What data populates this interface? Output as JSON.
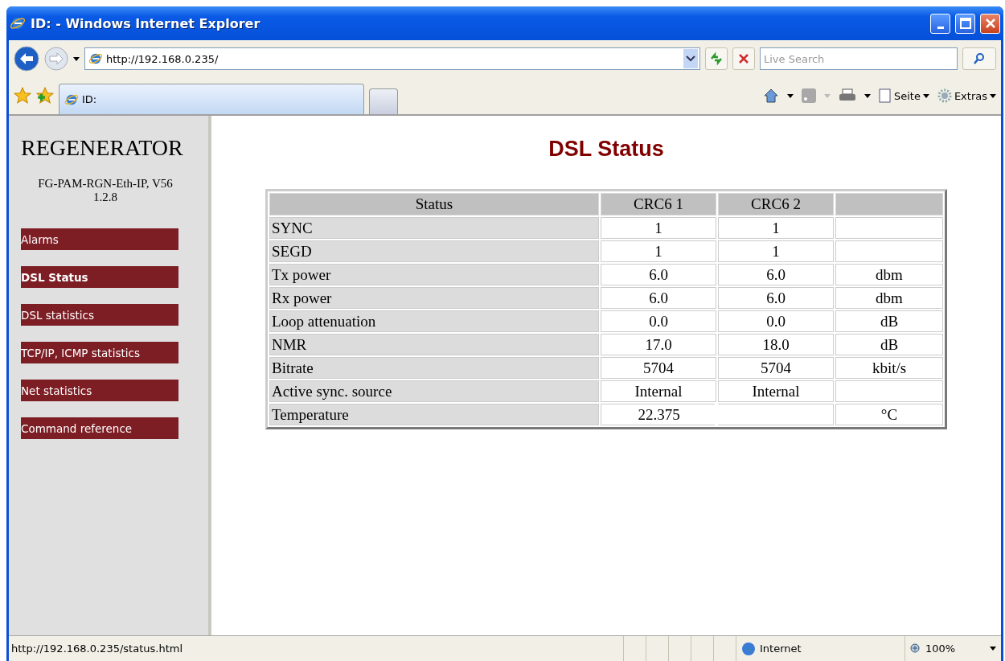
{
  "window": {
    "title": "ID: - Windows Internet Explorer"
  },
  "address_bar": {
    "value": "http://192.168.0.235/"
  },
  "search": {
    "placeholder": "Live Search"
  },
  "tabs": [
    {
      "label": "ID:",
      "selected": true
    }
  ],
  "command_bar": [
    "Seite",
    "Extras"
  ],
  "sidebar": {
    "title": "REGENERATOR",
    "subtitle": "FG-PAM-RGN-Eth-IP, V56",
    "version": "1.2.8",
    "items": [
      {
        "label": "Alarms",
        "selected": false
      },
      {
        "label": "DSL Status",
        "selected": true
      },
      {
        "label": "DSL statistics",
        "selected": false
      },
      {
        "label": "TCP/IP, ICMP statistics",
        "selected": false
      },
      {
        "label": "Net statistics",
        "selected": false
      },
      {
        "label": "Command reference",
        "selected": false
      }
    ]
  },
  "page": {
    "heading": "DSL Status"
  },
  "table": {
    "columns": [
      "Status",
      "CRC6 1",
      "CRC6 2"
    ],
    "rows": [
      {
        "merged": false,
        "cells": [
          "SYNC",
          "1",
          "1",
          ""
        ]
      },
      {
        "merged": false,
        "cells": [
          "SEGD",
          "1",
          "1",
          ""
        ]
      },
      {
        "merged": false,
        "cells": [
          "Tx power",
          "6.0",
          "6.0",
          "dbm"
        ]
      },
      {
        "merged": false,
        "cells": [
          "Rx power",
          "6.0",
          "6.0",
          "dbm"
        ]
      },
      {
        "merged": false,
        "cells": [
          "Loop attenuation",
          "0.0",
          "0.0",
          "dB"
        ]
      },
      {
        "merged": false,
        "cells": [
          "NMR",
          "17.0",
          "18.0",
          "dB"
        ]
      },
      {
        "merged": false,
        "cells": [
          "Bitrate",
          "5704",
          "5704",
          "kbit/s"
        ]
      },
      {
        "merged": false,
        "cells": [
          "Active sync. source",
          "Internal",
          "Internal",
          ""
        ]
      },
      {
        "merged": true,
        "cells": [
          "Temperature",
          "22.375",
          "",
          "°C"
        ]
      }
    ]
  },
  "status_bar": {
    "url": "http://192.168.0.235/status.html",
    "zone": "Internet",
    "zoom": "100%"
  }
}
